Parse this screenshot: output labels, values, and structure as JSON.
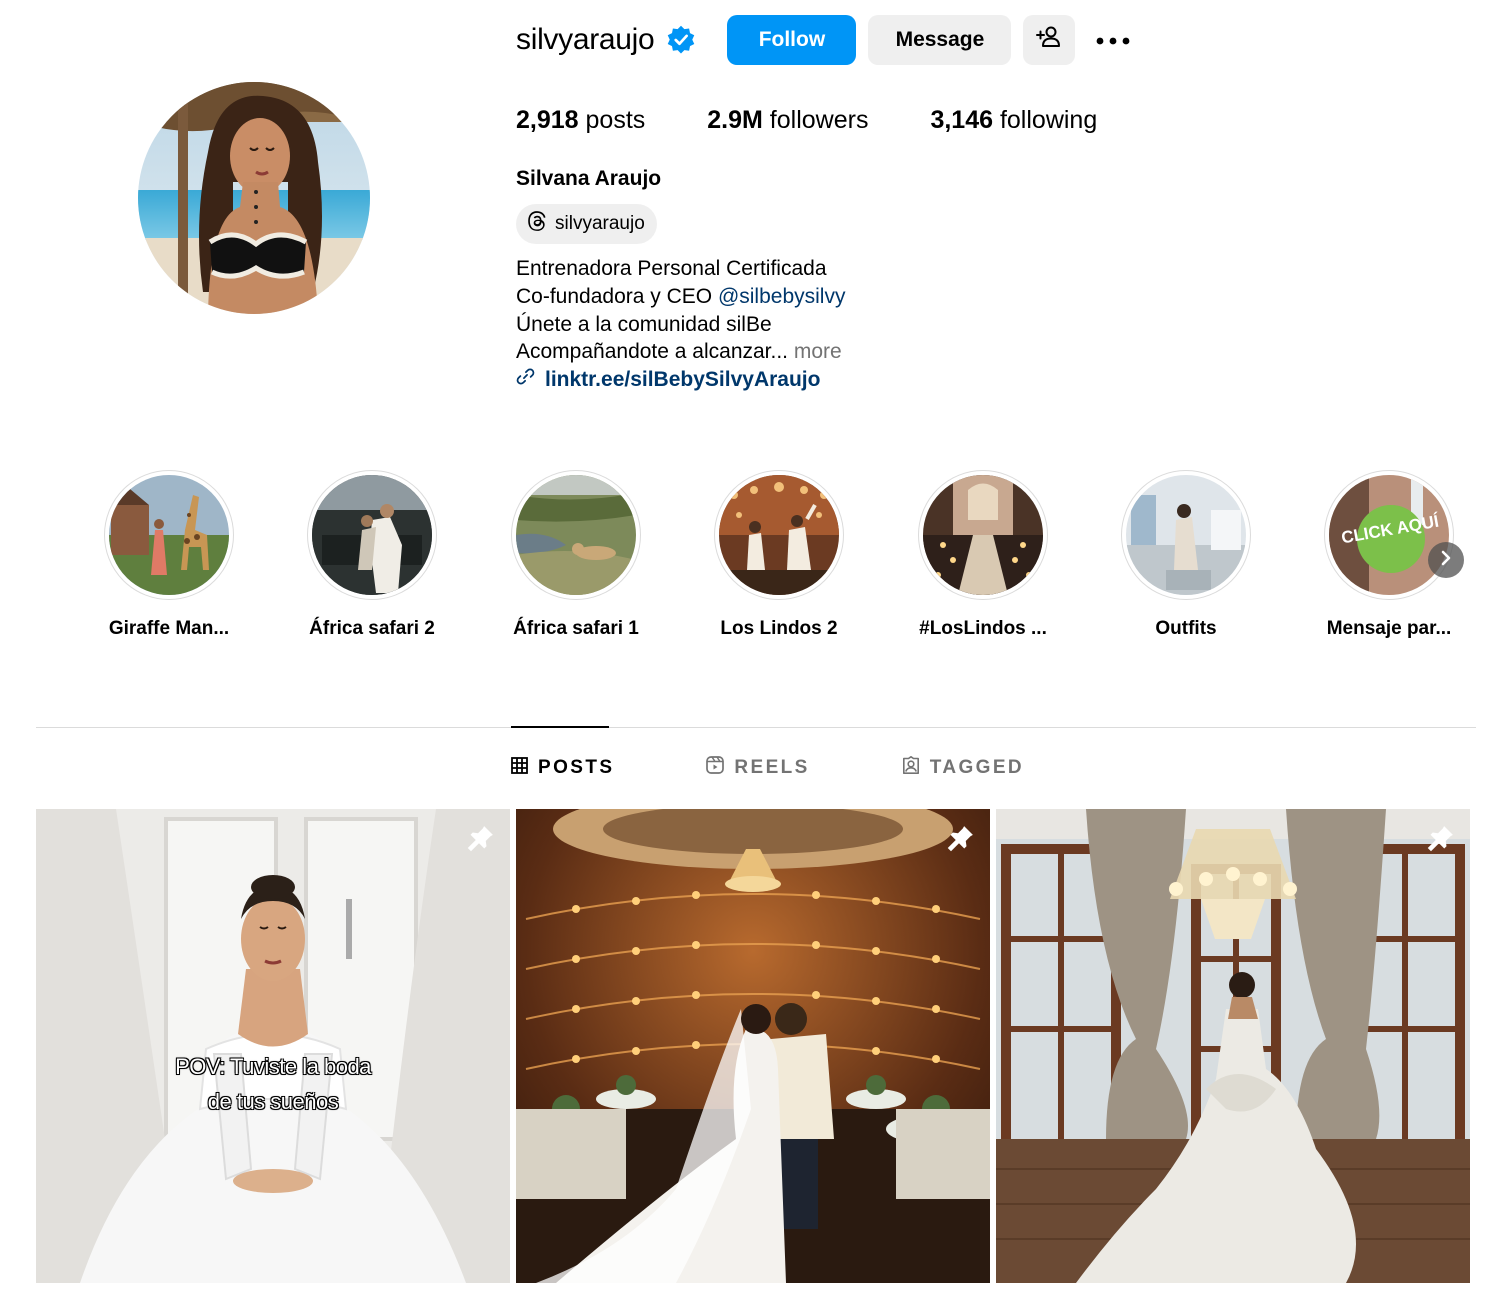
{
  "profile": {
    "username": "silvyaraujo",
    "verified_icon": "verified-badge-icon",
    "buttons": {
      "follow": "Follow",
      "message": "Message"
    },
    "stats": {
      "posts_count": "2,918",
      "posts_label": " posts",
      "followers_count": "2.9M",
      "followers_label": " followers",
      "following_count": "3,146",
      "following_label": " following"
    },
    "full_name": "Silvana Araujo",
    "threads_handle": "silvyaraujo",
    "bio": {
      "line1": "Entrenadora Personal Certificada",
      "line2_prefix": "Co-fundadora y CEO ",
      "line2_mention": "@silbebysilvy",
      "line3": "Únete a la comunidad silBe",
      "line4": "Acompañandote a alcanzar...",
      "more": " more",
      "link": "linktr.ee/silBebySilvyAraujo"
    }
  },
  "highlights": [
    {
      "label": "Giraffe Man..."
    },
    {
      "label": "África safari 2"
    },
    {
      "label": "África safari 1"
    },
    {
      "label": "Los Lindos 2"
    },
    {
      "label": "#LosLindos ..."
    },
    {
      "label": "Outfits"
    },
    {
      "label": "Mensaje par...",
      "badge": "CLICK AQUÍ"
    }
  ],
  "tabs": [
    {
      "label": "POSTS",
      "icon": "grid-icon",
      "active": true
    },
    {
      "label": "REELS",
      "icon": "reels-icon",
      "active": false
    },
    {
      "label": "TAGGED",
      "icon": "tagged-icon",
      "active": false
    }
  ],
  "posts": [
    {
      "pinned": true,
      "overlay_line1": "POV: Tuviste la boda",
      "overlay_line2": "de tus sueños"
    },
    {
      "pinned": true
    },
    {
      "pinned": true
    }
  ],
  "colors": {
    "follow_button": "#0095f6",
    "verified": "#0095f6",
    "link": "#00376b",
    "secondary_text": "#737373"
  }
}
